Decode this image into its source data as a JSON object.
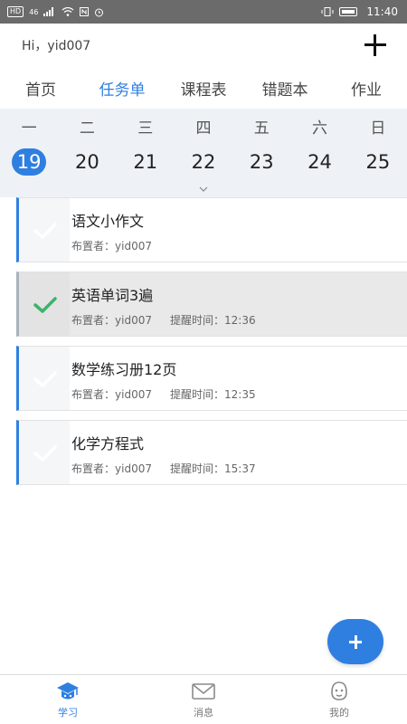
{
  "status_bar": {
    "hd": "HD",
    "signal": "46",
    "time": "11:40"
  },
  "header": {
    "greeting": "Hi，yid007"
  },
  "tabs": [
    {
      "label": "首页",
      "active": false
    },
    {
      "label": "任务单",
      "active": true
    },
    {
      "label": "课程表",
      "active": false
    },
    {
      "label": "错题本",
      "active": false
    },
    {
      "label": "作业",
      "active": false
    }
  ],
  "calendar": {
    "weekdays": [
      "一",
      "二",
      "三",
      "四",
      "五",
      "六",
      "日"
    ],
    "dates": [
      "19",
      "20",
      "21",
      "22",
      "23",
      "24",
      "25"
    ],
    "selected_date": "19"
  },
  "tasks": [
    {
      "title": "语文小作文",
      "assigner_label": "布置者：",
      "assigner": "yid007",
      "remind_label": "",
      "remind_time": "",
      "done": false
    },
    {
      "title": "英语单词3遍",
      "assigner_label": "布置者：",
      "assigner": "yid007",
      "remind_label": "提醒时间：",
      "remind_time": "12:36",
      "done": true
    },
    {
      "title": "数学练习册12页",
      "assigner_label": "布置者：",
      "assigner": "yid007",
      "remind_label": "提醒时间：",
      "remind_time": "12:35",
      "done": false
    },
    {
      "title": "化学方程式",
      "assigner_label": "布置者：",
      "assigner": "yid007",
      "remind_label": "提醒时间：",
      "remind_time": "15:37",
      "done": false
    }
  ],
  "bottom_nav": [
    {
      "label": "学习",
      "icon": "graduation-cap-icon",
      "active": true
    },
    {
      "label": "消息",
      "icon": "envelope-icon",
      "active": false
    },
    {
      "label": "我的",
      "icon": "profile-face-icon",
      "active": false
    }
  ],
  "colors": {
    "accent": "#2f7fe0",
    "done_check": "#3bb36b"
  }
}
